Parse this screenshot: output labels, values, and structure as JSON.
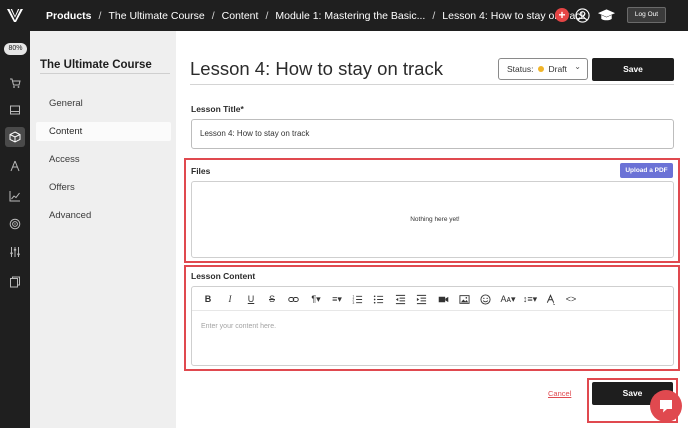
{
  "app": {
    "logo_icon": "v-logo-icon"
  },
  "breadcrumb": {
    "items": [
      "Products",
      "The Ultimate Course",
      "Content",
      "Module 1: Mastering the Basic...",
      "Lesson 4: How to stay on track"
    ],
    "separator": "/"
  },
  "topbar": {
    "add_icon": "plus-icon",
    "add_symbol": "+",
    "user_icon": "user-icon",
    "academy_icon": "graduation-cap-icon",
    "logout_label": "Log Out"
  },
  "rail": {
    "progress_label": "80%",
    "icons": [
      "cart-icon",
      "layout-icon",
      "box-icon",
      "funnel-icon",
      "chart-icon",
      "target-icon",
      "sliders-icon",
      "pages-icon"
    ],
    "active_icon": "box-icon"
  },
  "course_sidebar": {
    "title": "The Ultimate Course",
    "items": [
      "General",
      "Content",
      "Access",
      "Offers",
      "Advanced"
    ],
    "active": "Content"
  },
  "main": {
    "page_title": "Lesson 4: How to stay on track",
    "status_prefix": "Status:",
    "status_value": "Draft",
    "status_color": "#f0b429",
    "save_label": "Save",
    "lesson_title_label": "Lesson Title*",
    "lesson_title_value": "Lesson 4: How to stay on track",
    "files_label": "Files",
    "upload_label": "Upload a PDF",
    "files_empty": "Nothing here yet!",
    "content_label": "Lesson Content",
    "editor_placeholder": "Enter your content here.",
    "cancel_label": "Cancel",
    "save_bottom_label": "Save"
  },
  "editor_toolbar": {
    "bold": "B",
    "italic": "I",
    "underline": "U",
    "strike": "S",
    "paragraph": "¶▾",
    "align": "≡▾",
    "font_size": "Aᴀ▾",
    "line_height": "↕≡▾",
    "code": "<>"
  },
  "colors": {
    "accent_red": "#e0494f",
    "upload_purple": "#6b72d6",
    "dark": "#1e1e1e"
  }
}
